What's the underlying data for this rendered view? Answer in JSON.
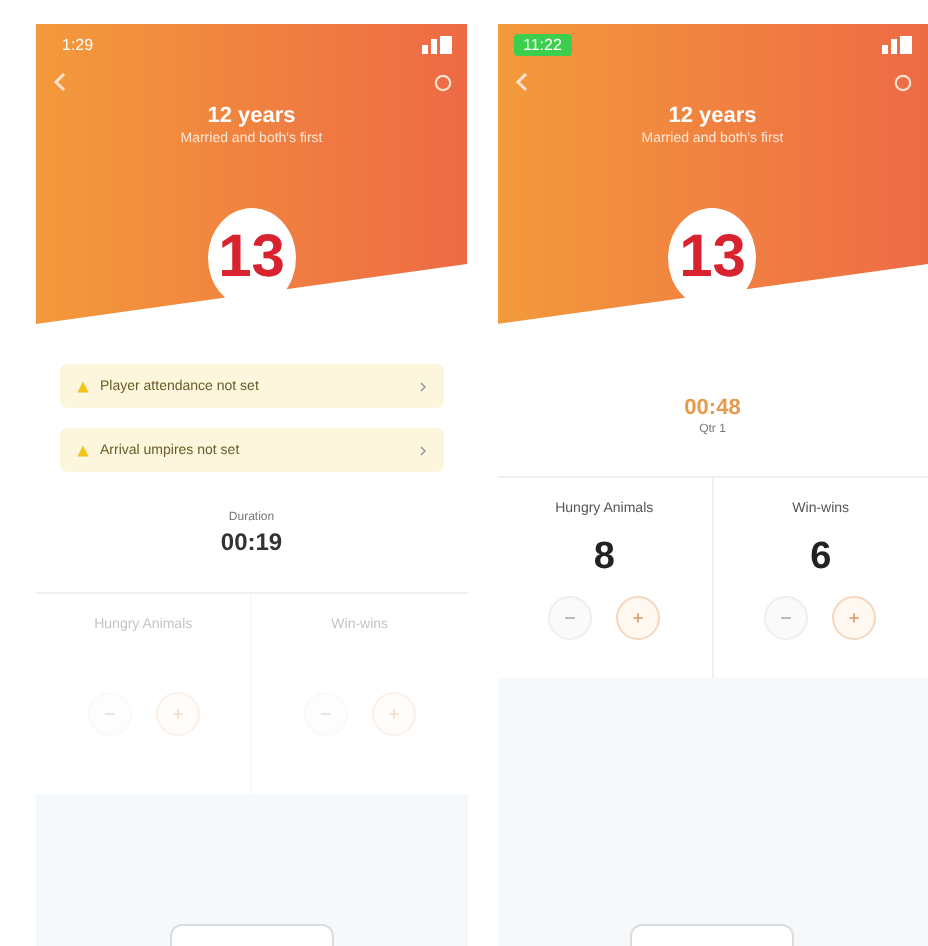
{
  "screens": [
    {
      "status_time": "1:29",
      "status_highlight": false,
      "title": "12 years",
      "subtitle": "Married and both's first",
      "badge": "13",
      "alerts": [
        {
          "text": "Player attendance not set"
        },
        {
          "text": "Arrival umpires not set"
        }
      ],
      "timer": {
        "label": "Duration",
        "value": "00:19",
        "running": false
      },
      "teams": [
        {
          "name": "Hungry Animals",
          "active": false
        },
        {
          "name": "Win-wins",
          "active": false
        }
      ]
    },
    {
      "status_time": "11:22",
      "status_highlight": true,
      "title": "12 years",
      "subtitle": "Married and both's first",
      "badge": "13",
      "timer": {
        "label": "Qtr 1",
        "value": "00:48",
        "running": true
      },
      "teams": [
        {
          "name": "Hungry Animals",
          "active": true,
          "score": "8"
        },
        {
          "name": "Win-wins",
          "active": true,
          "score": "6"
        }
      ]
    }
  ]
}
